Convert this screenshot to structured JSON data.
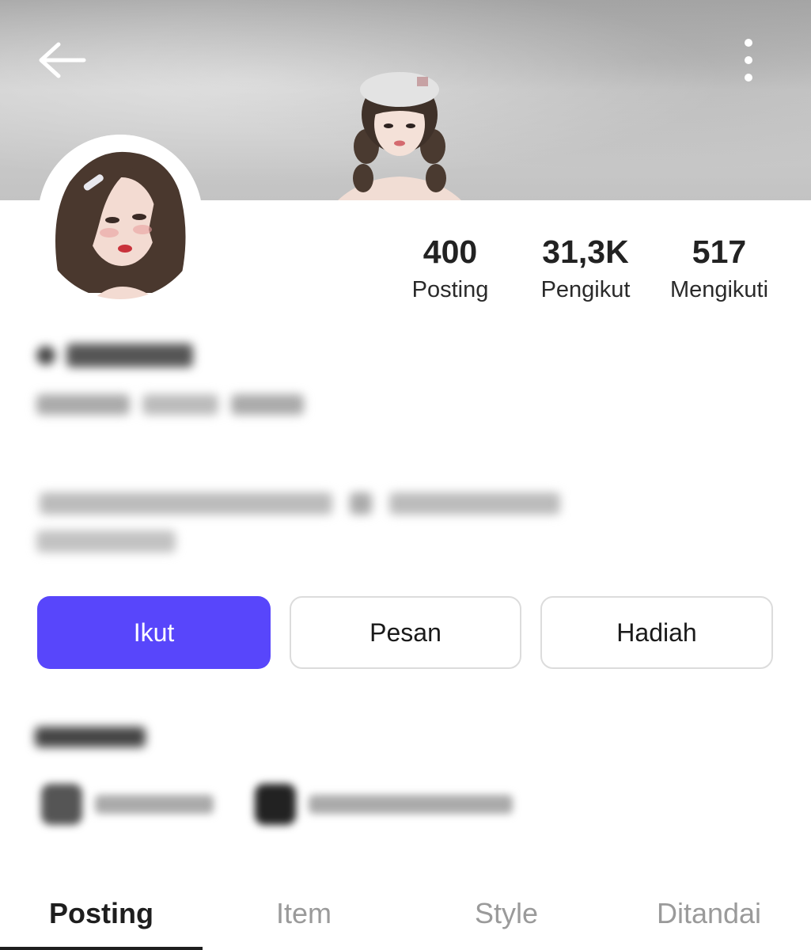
{
  "header": {
    "back_icon": "arrow-left-icon",
    "more_icon": "more-vertical-icon"
  },
  "stats": [
    {
      "value": "400",
      "label": "Posting"
    },
    {
      "value": "31,3K",
      "label": "Pengikut"
    },
    {
      "value": "517",
      "label": "Mengikuti"
    }
  ],
  "actions": {
    "follow": "Ikut",
    "message": "Pesan",
    "gift": "Hadiah"
  },
  "colors": {
    "accent": "#5846fb",
    "border": "#dcdcdc",
    "tab_active": "#1e1e1e",
    "tab_inactive": "#9a9a9a"
  },
  "tabs": [
    {
      "label": "Posting",
      "active": true
    },
    {
      "label": "Item",
      "active": false
    },
    {
      "label": "Style",
      "active": false
    },
    {
      "label": "Ditandai",
      "active": false
    }
  ]
}
